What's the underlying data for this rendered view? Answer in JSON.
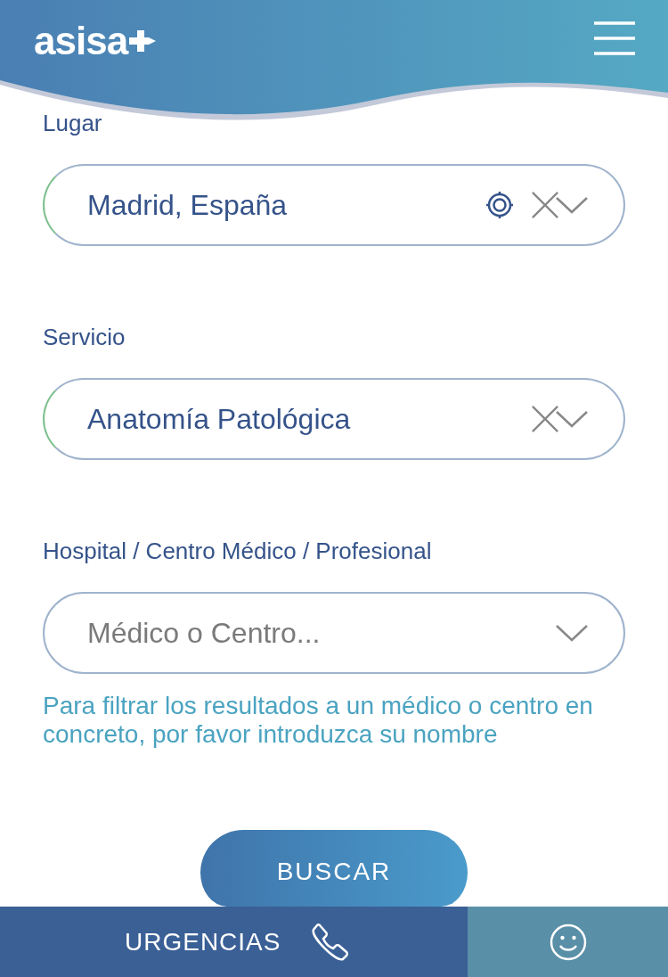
{
  "header": {
    "logo": "asisa"
  },
  "fields": [
    {
      "label": "Lugar",
      "value": "Madrid, España",
      "valid": true,
      "locate": true,
      "clearable": true
    },
    {
      "label": "Servicio",
      "value": "Anatomía Patológica",
      "valid": true,
      "locate": false,
      "clearable": true
    },
    {
      "label": "Hospital / Centro Médico / Profesional",
      "placeholder": "Médico o Centro...",
      "valid": false,
      "locate": false,
      "clearable": false,
      "hint": "Para filtrar los resultados a un médico o centro en concreto, por favor introduzca su nombre"
    }
  ],
  "search_button": "BUSCAR",
  "bottom_bar": {
    "emergency": "URGENCIAS"
  }
}
